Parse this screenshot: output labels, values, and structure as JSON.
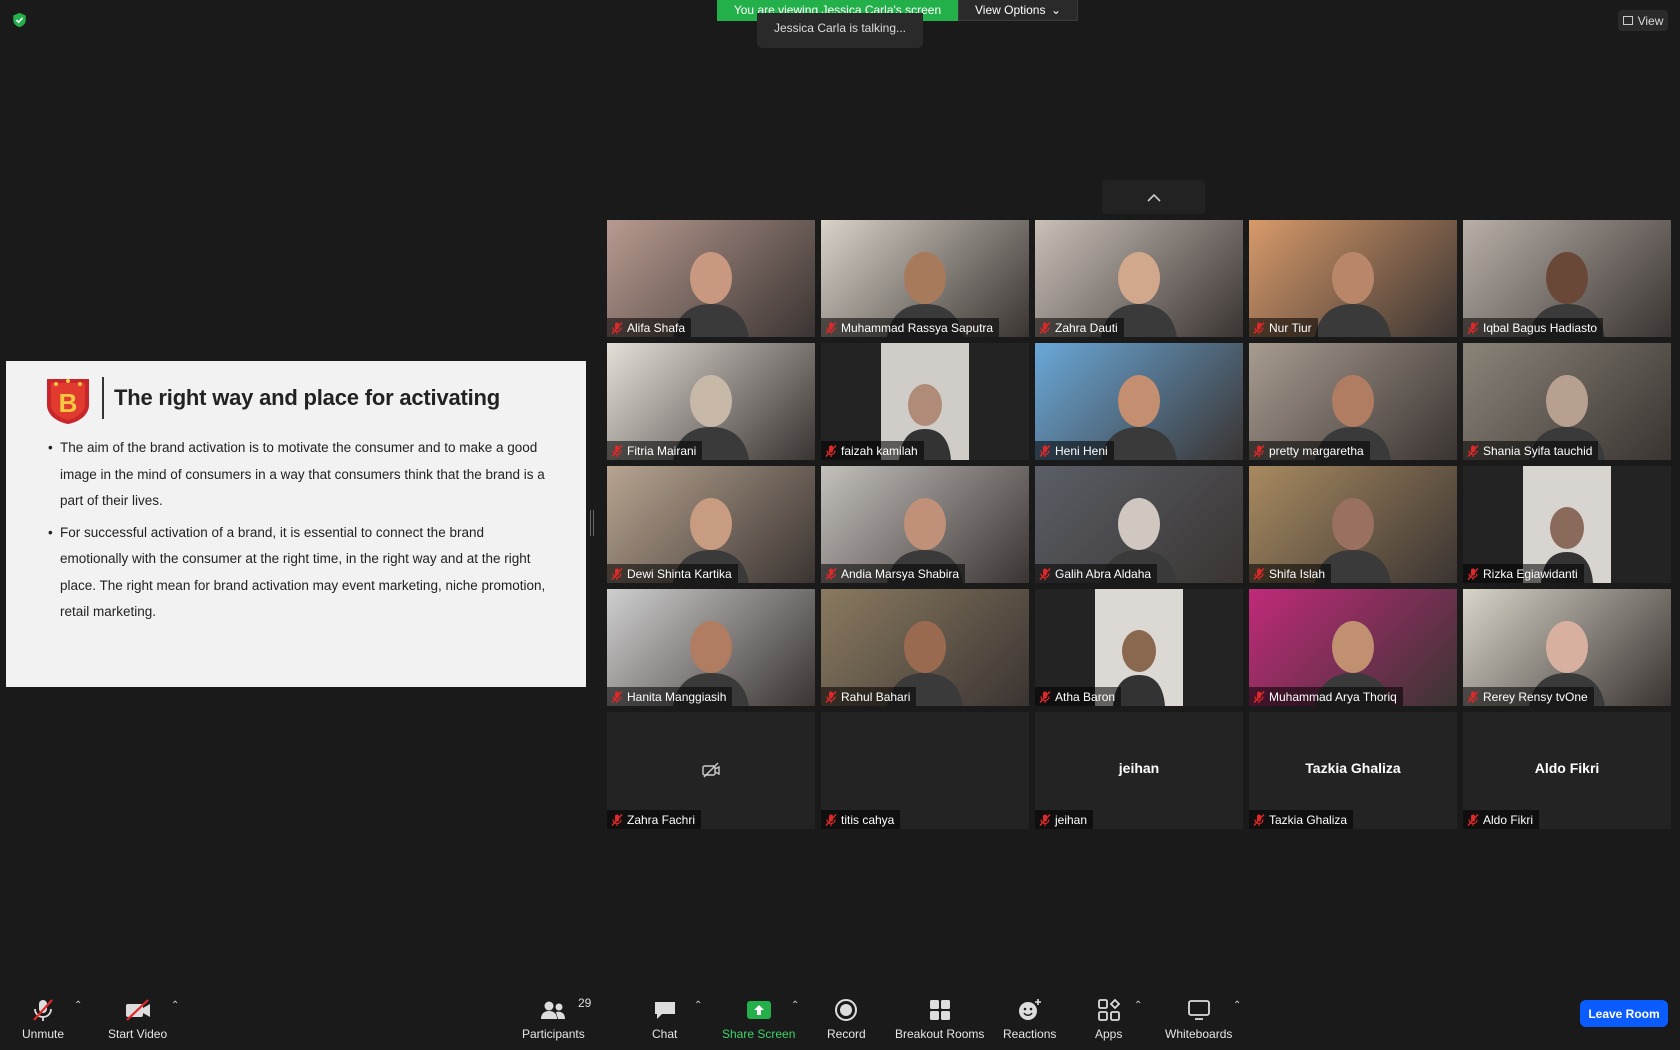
{
  "banner": {
    "viewing_text": "You are viewing Jessica Carla's screen",
    "view_options_label": "View Options",
    "talking_text": "Jessica Carla is talking..."
  },
  "view_button_label": "View",
  "slide": {
    "logo_letter": "B",
    "title": "The right way and place for activating",
    "bullets": [
      "The aim of the brand activation is to motivate the consumer and to make a good image in the mind of consumers in a way that consumers think that the brand is a part of their lives.",
      "For successful activation of a brand, it is essential to connect the brand emotionally with the consumer at the right time, in the right way and at the right place. The right mean for brand activation may event marketing, niche promotion, retail marketing."
    ]
  },
  "participants": [
    {
      "name": "Alifa Shafa",
      "bg": "#b89a90",
      "skin": "#c99880"
    },
    {
      "name": "Muhammad Rassya Saputra",
      "bg": "#d8d2c8",
      "skin": "#a87a5c"
    },
    {
      "name": "Zahra Dauti",
      "bg": "#c9c0b8",
      "skin": "#d2a88c"
    },
    {
      "name": "Nur Tiur",
      "bg": "#d89a6a",
      "skin": "#b8876a"
    },
    {
      "name": "Iqbal Bagus Hadiasto",
      "bg": "#b8b0a8",
      "skin": "#6a4838"
    },
    {
      "name": "Fitria Mairani",
      "bg": "#e4e0d8",
      "skin": "#c8b8a8"
    },
    {
      "name": "faizah kamilah",
      "bg": "#d0ccc8",
      "skin": "#b08c78",
      "narrow": true
    },
    {
      "name": "Heni Heni",
      "bg": "#6aa8d8",
      "skin": "#c48e70"
    },
    {
      "name": "pretty margaretha",
      "bg": "#a89c90",
      "skin": "#b07c62"
    },
    {
      "name": "Shania Syifa tauchid",
      "bg": "#8a8478",
      "skin": "#b8a090"
    },
    {
      "name": "Dewi Shinta Kartika",
      "bg": "#b8a490",
      "skin": "#c89c80"
    },
    {
      "name": "Andia Marsya Shabira",
      "bg": "#c4c0bc",
      "skin": "#c09078"
    },
    {
      "name": "Galih Abra Aldaha",
      "bg": "#5a5e66",
      "skin": "#d0c8c0"
    },
    {
      "name": "Shifa Islah",
      "bg": "#a88a60",
      "skin": "#9a7060"
    },
    {
      "name": "Rizka Egiawidanti",
      "bg": "#d8d4d0",
      "skin": "#8a6a5a",
      "narrow": true
    },
    {
      "name": "Hanita Manggiasih",
      "bg": "#cfcfcf",
      "skin": "#b07c62"
    },
    {
      "name": "Rahul Bahari",
      "bg": "#8a7a60",
      "skin": "#9a6a50"
    },
    {
      "name": "Atha Baron",
      "bg": "#dcd8d4",
      "skin": "#8a6850",
      "narrow": true
    },
    {
      "name": "Muhammad Arya Thoriq",
      "bg": "#c02a7a",
      "skin": "#c09070"
    },
    {
      "name": "Rerey Rensy tvOne",
      "bg": "#d8d4c8",
      "skin": "#d8b0a0"
    },
    {
      "name": "Zahra Fachri",
      "video": false,
      "camoff": true
    },
    {
      "name": "titis cahya",
      "video": false
    },
    {
      "name": "jeihan",
      "video": false,
      "big": "jeihan"
    },
    {
      "name": "Tazkia Ghaliza",
      "video": false,
      "big": "Tazkia Ghaliza"
    },
    {
      "name": "Aldo Fikri",
      "video": false,
      "big": "Aldo Fikri"
    }
  ],
  "toolbar": {
    "unmute": "Unmute",
    "start_video": "Start Video",
    "participants": "Participants",
    "participants_count": "29",
    "chat": "Chat",
    "share_screen": "Share Screen",
    "record": "Record",
    "breakout_rooms": "Breakout Rooms",
    "reactions": "Reactions",
    "apps": "Apps",
    "whiteboards": "Whiteboards",
    "leave": "Leave Room"
  },
  "colors": {
    "accent_green": "#23b04a",
    "leave_blue": "#0b5cff",
    "mute_red": "#e02828"
  }
}
